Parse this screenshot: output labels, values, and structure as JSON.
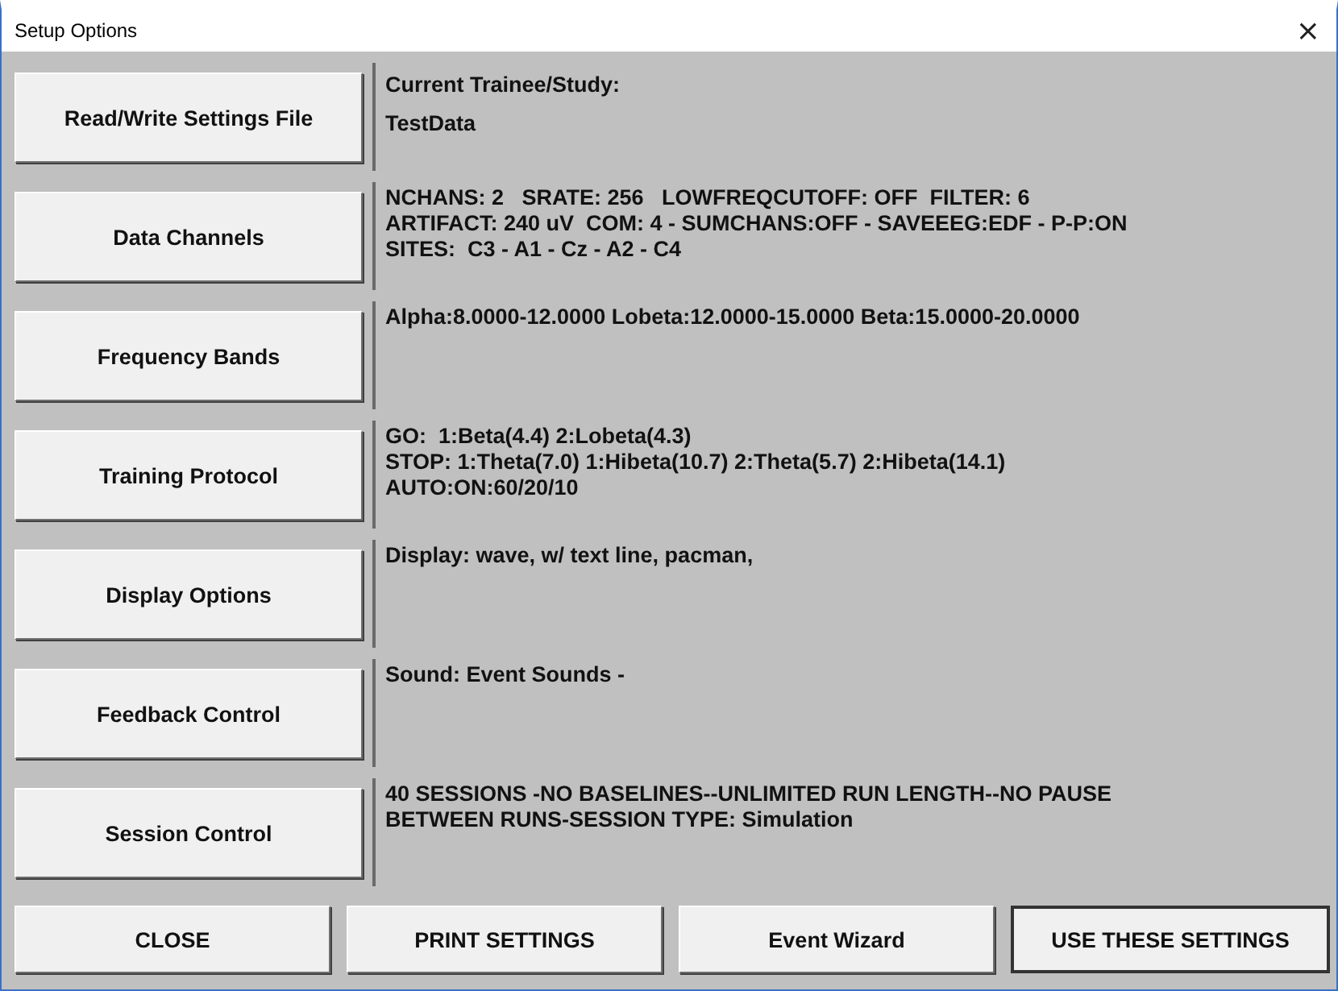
{
  "window": {
    "title": "Setup Options",
    "close": "×"
  },
  "sections": [
    {
      "button": "Read/Write Settings File",
      "lines": [
        "Current Trainee/Study:",
        "TestData"
      ]
    },
    {
      "button": "Data Channels",
      "lines": [
        "NCHANS: 2   SRATE: 256   LOWFREQCUTOFF: OFF  FILTER: 6",
        "ARTIFACT: 240 uV  COM: 4 - SUMCHANS:OFF - SAVEEEG:EDF - P-P:ON",
        "SITES:  C3 - A1 - Cz - A2 - C4"
      ]
    },
    {
      "button": "Frequency Bands",
      "lines": [
        "Alpha:8.0000-12.0000 Lobeta:12.0000-15.0000 Beta:15.0000-20.0000"
      ]
    },
    {
      "button": "Training Protocol",
      "lines": [
        "GO:  1:Beta(4.4) 2:Lobeta(4.3)",
        "STOP: 1:Theta(7.0) 1:Hibeta(10.7) 2:Theta(5.7) 2:Hibeta(14.1)",
        "AUTO:ON:60/20/10"
      ]
    },
    {
      "button": "Display Options",
      "lines": [
        "Display: wave, w/ text line, pacman,"
      ]
    },
    {
      "button": "Feedback Control",
      "lines": [
        "Sound: Event Sounds -"
      ]
    },
    {
      "button": "Session Control",
      "lines": [
        "40 SESSIONS -NO BASELINES--UNLIMITED RUN LENGTH--NO PAUSE",
        "BETWEEN RUNS-SESSION TYPE: Simulation"
      ]
    }
  ],
  "buttons": [
    {
      "label": "CLOSE",
      "default": false
    },
    {
      "label": "PRINT SETTINGS",
      "default": false
    },
    {
      "label": "Event Wizard",
      "default": false
    },
    {
      "label": "USE THESE SETTINGS",
      "default": true
    }
  ]
}
